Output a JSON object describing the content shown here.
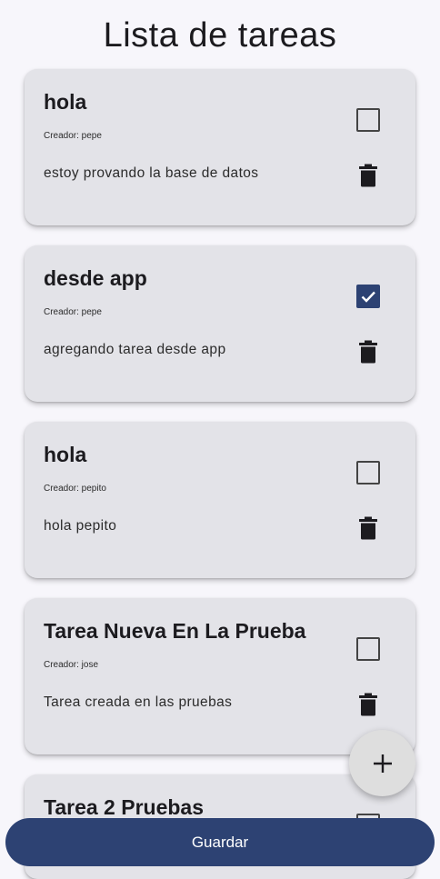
{
  "header": {
    "title": "Lista de tareas"
  },
  "tasks": [
    {
      "title": "hola",
      "creator": "Creador: pepe",
      "description": "estoy provando la base de datos",
      "checked": false
    },
    {
      "title": "desde app",
      "creator": "Creador: pepe",
      "description": "agregando tarea desde app",
      "checked": true
    },
    {
      "title": "hola",
      "creator": "Creador: pepito",
      "description": "hola pepito",
      "checked": false
    },
    {
      "title": "Tarea Nueva En La Prueba",
      "creator": "Creador: jose",
      "description": "Tarea creada en las pruebas",
      "checked": false
    },
    {
      "title": "Tarea 2 Pruebas",
      "checked": false
    }
  ],
  "fab": {
    "icon": "plus-icon"
  },
  "footer": {
    "save_label": "Guardar"
  },
  "colors": {
    "primary": "#2d4273",
    "card": "#e3e3e8",
    "background": "#f7f6fb"
  }
}
